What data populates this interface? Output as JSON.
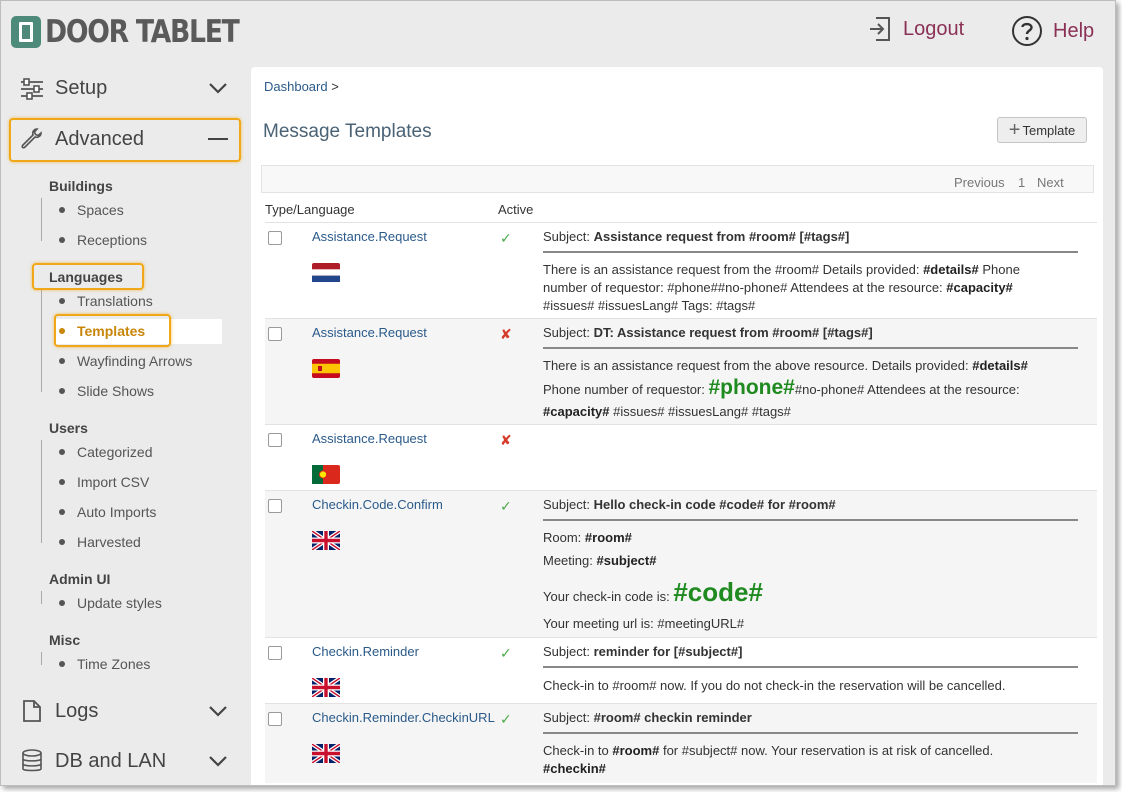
{
  "header": {
    "logo_text": "DOOR TABLET",
    "logout": "Logout",
    "help": "Help"
  },
  "sidebar": {
    "setup": "Setup",
    "advanced": "Advanced",
    "groups": {
      "buildings": "Buildings",
      "spaces": "Spaces",
      "receptions": "Receptions",
      "languages": "Languages",
      "translations": "Translations",
      "templates": "Templates",
      "wayfinding": "Wayfinding Arrows",
      "slideshows": "Slide Shows",
      "users": "Users",
      "categorized": "Categorized",
      "import_csv": "Import CSV",
      "auto_imports": "Auto Imports",
      "harvested": "Harvested",
      "admin_ui": "Admin UI",
      "update_styles": "Update styles",
      "misc": "Misc",
      "time_zones": "Time Zones"
    },
    "logs": "Logs",
    "db_lan": "DB and LAN"
  },
  "main": {
    "breadcrumb": "Dashboard",
    "breadcrumb_sep": ">",
    "title": "Message Templates",
    "add_button": "Template",
    "pager": {
      "previous": "Previous",
      "page": "1",
      "next": "Next"
    },
    "columns": {
      "type_language": "Type/Language",
      "active": "Active"
    },
    "rows": [
      {
        "name": "Assistance.Request",
        "active": true,
        "flag": "netherlands",
        "subject_label": "Subject:",
        "subject": "Assistance request from #room# [#tags#]",
        "body": [
          "There is an assistance request from the  #room# Details provided: ",
          "#details#",
          " Phone",
          "number of requestor: #phone##no-phone# Attendees at the resource: ",
          "#capacity#",
          "#issues# #issuesLang# Tags: #tags#"
        ]
      },
      {
        "name": "Assistance.Request",
        "active": false,
        "flag": "spain",
        "subject_label": "Subject:",
        "subject": "DT: Assistance request from #room# [#tags#]",
        "body": [
          "There is an assistance request from the above resource. Details provided: ",
          "#details#",
          "Phone number of requestor: ",
          "#phone#",
          "#no-phone# Attendees at the resource:",
          "#capacity#",
          " #issues# #issuesLang# #tags#"
        ]
      },
      {
        "name": "Assistance.Request",
        "active": false,
        "flag": "portugal"
      },
      {
        "name": "Checkin.Code.Confirm",
        "active": true,
        "flag": "uk",
        "subject_label": "Subject:",
        "subject": "Hello check-in code #code# for #room#",
        "body": [
          "Room: ",
          "#room#",
          "Meeting: ",
          "#subject#",
          "Your check-in code is: ",
          "#code#",
          "Your meeting url is: #meetingURL#"
        ]
      },
      {
        "name": "Checkin.Reminder",
        "active": true,
        "flag": "uk",
        "subject_label": "Subject:",
        "subject": "reminder for [#subject#]",
        "body": [
          "Check-in to #room# now.  If you do not check-in the reservation will be cancelled."
        ]
      },
      {
        "name": "Checkin.Reminder.CheckinURL",
        "active": true,
        "flag": "uk",
        "subject_label": "Subject:",
        "subject": "#room# checkin reminder",
        "body": [
          "Check-in to ",
          "#room#",
          " for #subject# now. Your reservation is at risk of cancelled.",
          "#checkin#"
        ]
      }
    ]
  },
  "colors": {
    "accent": "#8a3155",
    "link": "#2a5a8a",
    "highlight": "#f0a818",
    "active_item": "#c8860a",
    "check_green": "#4aa84a",
    "cross_red": "#d63b2a",
    "big_green": "#1f8a1f"
  },
  "icons": {
    "setup": "sliders-icon",
    "advanced": "wrench-icon",
    "logs": "file-icon",
    "db_lan": "database-icon",
    "logout": "logout-icon",
    "help": "help-circle-icon"
  }
}
